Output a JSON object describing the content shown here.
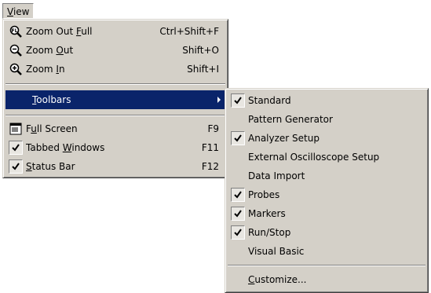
{
  "menubar": {
    "view_label": "View",
    "view_mnemonic": "V",
    "view_rest": "iew"
  },
  "view_menu": {
    "items": [
      {
        "label_pre": "Zoom Out ",
        "label_m": "F",
        "label_post": "ull",
        "shortcut": "Ctrl+Shift+F",
        "icon": "zoom-out-full-icon"
      },
      {
        "label_pre": "Zoom ",
        "label_m": "O",
        "label_post": "ut",
        "shortcut": "Shift+O",
        "icon": "zoom-out-icon"
      },
      {
        "label_pre": "Zoom ",
        "label_m": "I",
        "label_post": "n",
        "shortcut": "Shift+I",
        "icon": "zoom-in-icon"
      },
      {
        "label_pre": "",
        "label_m": "T",
        "label_post": "oolbars",
        "shortcut": "",
        "icon": "submenu-arrow-icon",
        "highlighted": true
      },
      {
        "label_pre": "F",
        "label_m": "u",
        "label_post": "ll Screen",
        "shortcut": "F9",
        "icon": "full-screen-icon"
      },
      {
        "label_pre": "Tabbed ",
        "label_m": "W",
        "label_post": "indows",
        "shortcut": "F11",
        "icon": "checkmark-icon",
        "checked": true
      },
      {
        "label_pre": "",
        "label_m": "S",
        "label_post": "tatus Bar",
        "shortcut": "F12",
        "icon": "checkmark-icon",
        "checked": true
      }
    ]
  },
  "toolbars_menu": {
    "items": [
      {
        "label": "Standard",
        "checked": true
      },
      {
        "label": "Pattern Generator",
        "checked": false
      },
      {
        "label": "Analyzer Setup",
        "checked": true
      },
      {
        "label": "External Oscilloscope Setup",
        "checked": false
      },
      {
        "label": "Data Import",
        "checked": false
      },
      {
        "label": "Probes",
        "checked": true
      },
      {
        "label": "Markers",
        "checked": true
      },
      {
        "label": "Run/Stop",
        "checked": true
      },
      {
        "label": "Visual Basic",
        "checked": false
      }
    ],
    "customize": {
      "label_m": "C",
      "label_post": "ustomize..."
    }
  },
  "colors": {
    "menu_bg": "#d4d0c8",
    "highlight": "#0a246a"
  }
}
